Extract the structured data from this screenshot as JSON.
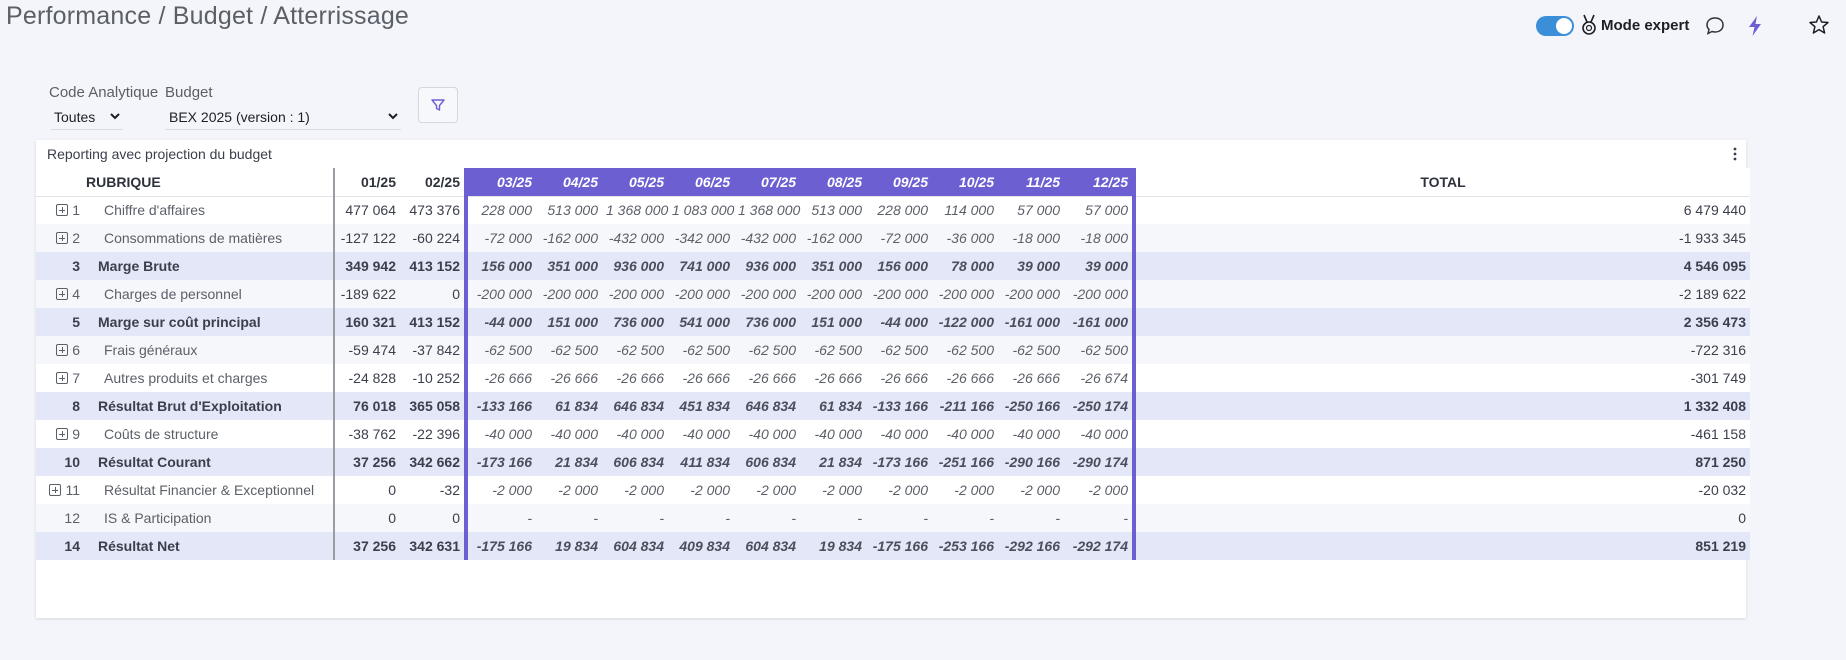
{
  "breadcrumb": "Performance / Budget / Atterrissage",
  "topbar": {
    "expert_label": "Mode expert",
    "toggle_on": true
  },
  "filters": {
    "code_label": "Code Analytique",
    "code_value": "Toutes",
    "budget_label": "Budget",
    "budget_value": "BEX 2025 (version : 1)"
  },
  "card": {
    "title": "Reporting avec projection du budget"
  },
  "columns": {
    "rubrique": "RUBRIQUE",
    "actual": [
      "01/25",
      "02/25"
    ],
    "projected": [
      "03/25",
      "04/25",
      "05/25",
      "06/25",
      "07/25",
      "08/25",
      "09/25",
      "10/25",
      "11/25",
      "12/25"
    ],
    "total": "TOTAL"
  },
  "rows": [
    {
      "idx": "1",
      "label": "Chiffre d'affaires",
      "expand": true,
      "sub": false,
      "actual": [
        "477 064",
        "473 376"
      ],
      "proj": [
        "228 000",
        "513 000",
        "1 368 000",
        "1 083 000",
        "1 368 000",
        "513 000",
        "228 000",
        "114 000",
        "57 000",
        "57 000"
      ],
      "total": "6 479 440"
    },
    {
      "idx": "2",
      "label": "Consommations de matières",
      "expand": true,
      "sub": false,
      "actual": [
        "-127 122",
        "-60 224"
      ],
      "proj": [
        "-72 000",
        "-162 000",
        "-432 000",
        "-342 000",
        "-432 000",
        "-162 000",
        "-72 000",
        "-36 000",
        "-18 000",
        "-18 000"
      ],
      "total": "-1 933 345"
    },
    {
      "idx": "3",
      "label": "Marge Brute",
      "expand": false,
      "sub": true,
      "actual": [
        "349 942",
        "413 152"
      ],
      "proj": [
        "156 000",
        "351 000",
        "936 000",
        "741 000",
        "936 000",
        "351 000",
        "156 000",
        "78 000",
        "39 000",
        "39 000"
      ],
      "total": "4 546 095"
    },
    {
      "idx": "4",
      "label": "Charges de personnel",
      "expand": true,
      "sub": false,
      "actual": [
        "-189 622",
        "0"
      ],
      "proj": [
        "-200 000",
        "-200 000",
        "-200 000",
        "-200 000",
        "-200 000",
        "-200 000",
        "-200 000",
        "-200 000",
        "-200 000",
        "-200 000"
      ],
      "total": "-2 189 622"
    },
    {
      "idx": "5",
      "label": "Marge sur coût principal",
      "expand": false,
      "sub": true,
      "actual": [
        "160 321",
        "413 152"
      ],
      "proj": [
        "-44 000",
        "151 000",
        "736 000",
        "541 000",
        "736 000",
        "151 000",
        "-44 000",
        "-122 000",
        "-161 000",
        "-161 000"
      ],
      "total": "2 356 473"
    },
    {
      "idx": "6",
      "label": "Frais généraux",
      "expand": true,
      "sub": false,
      "actual": [
        "-59 474",
        "-37 842"
      ],
      "proj": [
        "-62 500",
        "-62 500",
        "-62 500",
        "-62 500",
        "-62 500",
        "-62 500",
        "-62 500",
        "-62 500",
        "-62 500",
        "-62 500"
      ],
      "total": "-722 316"
    },
    {
      "idx": "7",
      "label": "Autres produits et charges",
      "expand": true,
      "sub": false,
      "actual": [
        "-24 828",
        "-10 252"
      ],
      "proj": [
        "-26 666",
        "-26 666",
        "-26 666",
        "-26 666",
        "-26 666",
        "-26 666",
        "-26 666",
        "-26 666",
        "-26 666",
        "-26 674"
      ],
      "total": "-301 749"
    },
    {
      "idx": "8",
      "label": "Résultat Brut d'Exploitation",
      "expand": false,
      "sub": true,
      "actual": [
        "76 018",
        "365 058"
      ],
      "proj": [
        "-133 166",
        "61 834",
        "646 834",
        "451 834",
        "646 834",
        "61 834",
        "-133 166",
        "-211 166",
        "-250 166",
        "-250 174"
      ],
      "total": "1 332 408"
    },
    {
      "idx": "9",
      "label": "Coûts de structure",
      "expand": true,
      "sub": false,
      "actual": [
        "-38 762",
        "-22 396"
      ],
      "proj": [
        "-40 000",
        "-40 000",
        "-40 000",
        "-40 000",
        "-40 000",
        "-40 000",
        "-40 000",
        "-40 000",
        "-40 000",
        "-40 000"
      ],
      "total": "-461 158"
    },
    {
      "idx": "10",
      "label": "Résultat Courant",
      "expand": false,
      "sub": true,
      "actual": [
        "37 256",
        "342 662"
      ],
      "proj": [
        "-173 166",
        "21 834",
        "606 834",
        "411 834",
        "606 834",
        "21 834",
        "-173 166",
        "-251 166",
        "-290 166",
        "-290 174"
      ],
      "total": "871 250"
    },
    {
      "idx": "11",
      "label": "Résultat Financier & Exceptionnel",
      "expand": true,
      "sub": false,
      "actual": [
        "0",
        "-32"
      ],
      "proj": [
        "-2 000",
        "-2 000",
        "-2 000",
        "-2 000",
        "-2 000",
        "-2 000",
        "-2 000",
        "-2 000",
        "-2 000",
        "-2 000"
      ],
      "total": "-20 032"
    },
    {
      "idx": "12",
      "label": "IS & Participation",
      "expand": false,
      "sub": false,
      "actual": [
        "0",
        "0"
      ],
      "proj": [
        "-",
        "-",
        "-",
        "-",
        "-",
        "-",
        "-",
        "-",
        "-",
        "-"
      ],
      "total": "0"
    },
    {
      "idx": "14",
      "label": "Résultat Net",
      "expand": false,
      "sub": true,
      "actual": [
        "37 256",
        "342 631"
      ],
      "proj": [
        "-175 166",
        "19 834",
        "604 834",
        "409 834",
        "604 834",
        "19 834",
        "-175 166",
        "-253 166",
        "-292 166",
        "-292 174"
      ],
      "total": "851 219"
    }
  ],
  "colors": {
    "accent": "#6c5fd1",
    "toggle": "#3b8fd9",
    "subtotal_bg": "#e4e7f7"
  },
  "icons": {
    "toggle": "switch-icon",
    "medal": "medal-icon",
    "comment": "comment-icon",
    "bolt": "bolt-icon",
    "star": "star-icon",
    "filter": "filter-icon",
    "kebab": "kebab-icon",
    "expand": "plus-square-icon"
  }
}
